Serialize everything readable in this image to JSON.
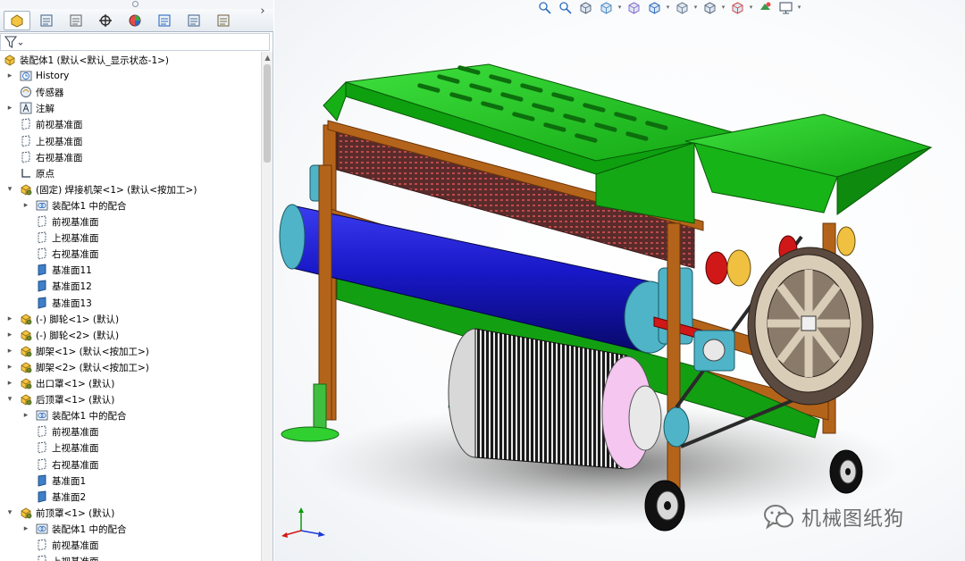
{
  "feature_tree": {
    "root_label": "装配体1  (默认<默认_显示状态-1>)",
    "items": [
      {
        "label": "History",
        "icon": "history-icon",
        "expander": "collapsed",
        "indent": 1
      },
      {
        "label": "传感器",
        "icon": "sensor-icon",
        "expander": "none",
        "indent": 1
      },
      {
        "label": "注解",
        "icon": "annotation-icon",
        "expander": "collapsed",
        "indent": 1
      },
      {
        "label": "前视基准面",
        "icon": "plane-icon",
        "expander": "none",
        "indent": 1
      },
      {
        "label": "上视基准面",
        "icon": "plane-icon",
        "expander": "none",
        "indent": 1
      },
      {
        "label": "右视基准面",
        "icon": "plane-icon",
        "expander": "none",
        "indent": 1
      },
      {
        "label": "原点",
        "icon": "origin-icon",
        "expander": "none",
        "indent": 1
      },
      {
        "label": "(固定) 焊接机架<1> (默认<按加工>)",
        "icon": "part-icon",
        "expander": "expanded",
        "indent": 1
      },
      {
        "label": "装配体1 中的配合",
        "icon": "mates-icon",
        "expander": "collapsed",
        "indent": 2
      },
      {
        "label": "前视基准面",
        "icon": "plane-icon",
        "expander": "none",
        "indent": 2
      },
      {
        "label": "上视基准面",
        "icon": "plane-icon",
        "expander": "none",
        "indent": 2
      },
      {
        "label": "右视基准面",
        "icon": "plane-icon",
        "expander": "none",
        "indent": 2
      },
      {
        "label": "基准面11",
        "icon": "ref-plane-icon",
        "expander": "none",
        "indent": 2
      },
      {
        "label": "基准面12",
        "icon": "ref-plane-icon",
        "expander": "none",
        "indent": 2
      },
      {
        "label": "基准面13",
        "icon": "ref-plane-icon",
        "expander": "none",
        "indent": 2
      },
      {
        "label": "(-) 脚轮<1> (默认)",
        "icon": "part-icon",
        "expander": "collapsed",
        "indent": 1
      },
      {
        "label": "(-) 脚轮<2> (默认)",
        "icon": "part-icon",
        "expander": "collapsed",
        "indent": 1
      },
      {
        "label": "脚架<1> (默认<按加工>)",
        "icon": "part-icon",
        "expander": "collapsed",
        "indent": 1
      },
      {
        "label": "脚架<2> (默认<按加工>)",
        "icon": "part-icon",
        "expander": "collapsed",
        "indent": 1
      },
      {
        "label": "出口罩<1> (默认)",
        "icon": "part-icon",
        "expander": "collapsed",
        "indent": 1
      },
      {
        "label": "后顶罩<1> (默认)",
        "icon": "part-icon",
        "expander": "expanded",
        "indent": 1
      },
      {
        "label": "装配体1 中的配合",
        "icon": "mates-icon",
        "expander": "collapsed",
        "indent": 2
      },
      {
        "label": "前视基准面",
        "icon": "plane-icon",
        "expander": "none",
        "indent": 2
      },
      {
        "label": "上视基准面",
        "icon": "plane-icon",
        "expander": "none",
        "indent": 2
      },
      {
        "label": "右视基准面",
        "icon": "plane-icon",
        "expander": "none",
        "indent": 2
      },
      {
        "label": "基准面1",
        "icon": "ref-plane-icon",
        "expander": "none",
        "indent": 2
      },
      {
        "label": "基准面2",
        "icon": "ref-plane-icon",
        "expander": "none",
        "indent": 2
      },
      {
        "label": "前顶罩<1> (默认)",
        "icon": "part-icon",
        "expander": "expanded",
        "indent": 1
      },
      {
        "label": "装配体1 中的配合",
        "icon": "mates-icon",
        "expander": "collapsed",
        "indent": 2
      },
      {
        "label": "前视基准面",
        "icon": "plane-icon",
        "expander": "none",
        "indent": 2
      },
      {
        "label": "上视基准面",
        "icon": "plane-icon",
        "expander": "none",
        "indent": 2
      }
    ]
  },
  "panel_tabs": [
    {
      "name": "feature-manager-tab",
      "active": true
    },
    {
      "name": "property-manager-tab",
      "active": false
    },
    {
      "name": "configuration-manager-tab",
      "active": false
    },
    {
      "name": "dimxpert-manager-tab",
      "active": false
    },
    {
      "name": "display-manager-tab",
      "active": false
    },
    {
      "name": "cam-feature-tab",
      "active": false
    },
    {
      "name": "cam-operation-tab",
      "active": false
    },
    {
      "name": "cam-tool-tab",
      "active": false
    }
  ],
  "heads_up_toolbar": [
    "zoom-to-fit-icon",
    "zoom-to-area-icon",
    "previous-view-icon",
    "section-view-icon",
    "dynamic-annotation-icon",
    "view-orientation-icon",
    "display-style-icon",
    "hide-show-items-icon",
    "edit-appearance-icon",
    "apply-scene-icon",
    "view-settings-icon"
  ],
  "watermark": {
    "text": "机械图纸狗"
  },
  "colors": {
    "hopper_green": "#1fc21f",
    "frame_orange": "#b4641a",
    "roller_blue": "#1616c8",
    "pulley_cyan": "#4fb4c8",
    "motor_black": "#222222"
  }
}
